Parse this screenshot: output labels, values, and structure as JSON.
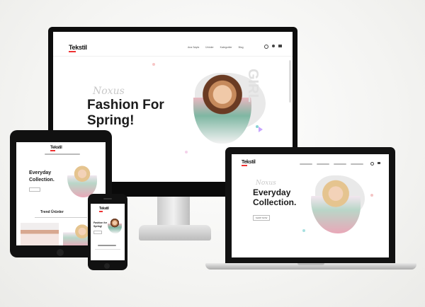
{
  "brand": {
    "name": "Tekstil"
  },
  "monitor": {
    "nav": [
      "Ana Sayfa",
      "Ürünler",
      "Kategoriler",
      "Blog"
    ],
    "hero_script": "Noxus",
    "hero_line1": "Fashion For",
    "hero_line2": "Spring!",
    "side_text": "GIRL"
  },
  "laptop": {
    "hero_script": "Noxus",
    "hero_line1": "Everyday",
    "hero_line2": "Collection.",
    "button": "SHOP NOW"
  },
  "tablet": {
    "hero_line1": "Everyday",
    "hero_line2": "Collection.",
    "section_title": "Trend Ürünler"
  },
  "phone": {
    "hero_line1": "Fashion for",
    "hero_line2": "Spring!"
  },
  "colors": {
    "accent": "#e33b3b",
    "device_black": "#111111",
    "background": "#f2f2f0"
  }
}
